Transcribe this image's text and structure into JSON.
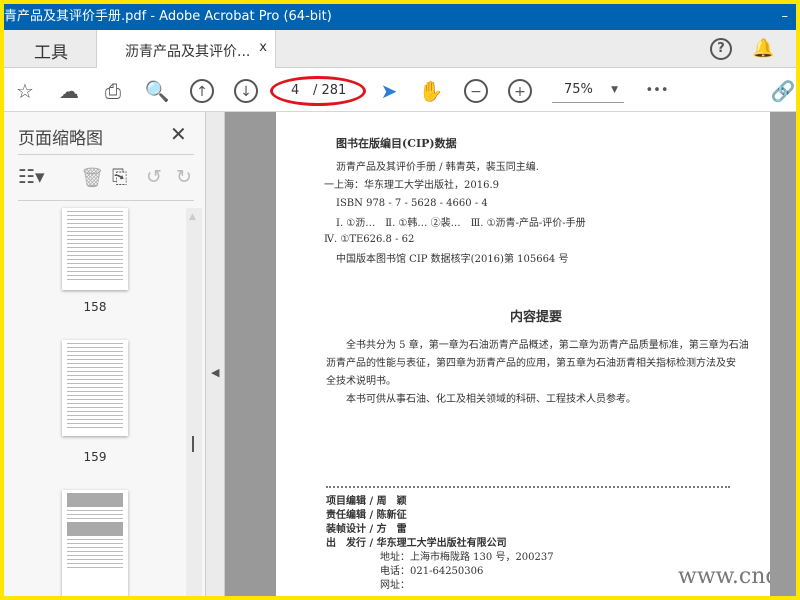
{
  "window": {
    "title": "青产品及其评价手册.pdf - Adobe Acrobat Pro (64-bit)",
    "minimize": "–"
  },
  "tabs": {
    "tools": "工具",
    "document": "沥青产品及其评价...",
    "close": "x"
  },
  "topright": {
    "help": "?",
    "bell": "🔔",
    "more": "⋮"
  },
  "toolbar": {
    "page_current": "4",
    "page_total": "/ 281",
    "zoom": "75%",
    "zoom_arrow": "▼",
    "more": "•••"
  },
  "sidebar": {
    "title": "页面缩略图",
    "close": "✕",
    "thumbnails": [
      {
        "label": "158"
      },
      {
        "label": "159"
      },
      {
        "label": ""
      }
    ]
  },
  "page": {
    "cip_title": "图书在版编目(CIP)数据",
    "cip_lines": [
      "沥青产品及其评价手册 / 韩青英，裴玉同主编.",
      "一上海：华东理工大学出版社，2016.9",
      "ISBN 978 - 7 - 5628 - 4660 - 4",
      "Ⅰ. ①沥…　Ⅱ. ①韩… ②裴…　Ⅲ. ①沥青-产品-评价-手册",
      "Ⅳ. ①TE626.8 - 62",
      "中国版本图书馆 CIP 数据核字(2016)第 105664 号"
    ],
    "summary_title": "内容提要",
    "summary_lines": [
      "全书共分为 5 章，第一章为石油沥青产品概述，第二章为沥青产品质量标准，第三章为石油",
      "沥青产品的性能与表征，第四章为沥青产品的应用，第五章为石油沥青相关指标检测方法及安",
      "全技术说明书。",
      "本书可供从事石油、化工及相关领域的科研、工程技术人员参考。"
    ],
    "credits": [
      "项目编辑 / 周　颖",
      "责任编辑 / 陈新征",
      "装帧设计 / 方　雷",
      "出　发行 / 华东理工大学出版社有限公司"
    ],
    "address": [
      "地址：上海市梅陇路 130 号，200237",
      "电话：021-64250306",
      "网址："
    ]
  },
  "watermark": "www.cndao.co"
}
